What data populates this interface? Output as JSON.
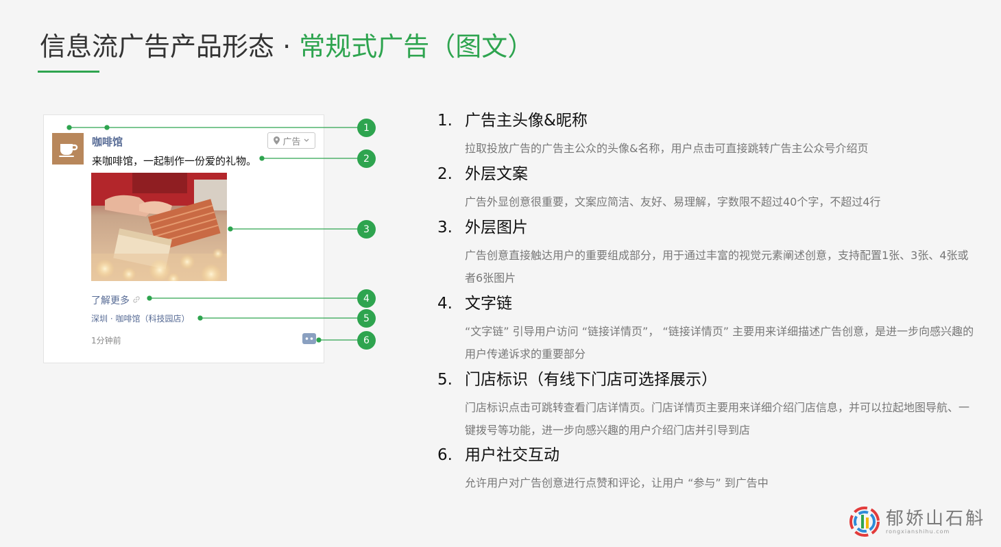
{
  "header": {
    "title_main": "信息流广告产品形态 · ",
    "title_accent": "常规式广告（图文）"
  },
  "ad_mock": {
    "nickname": "咖啡馆",
    "ad_tag": "广告",
    "copy": "来咖啡馆，一起制作一份爱的礼物。",
    "learn_more": "了解更多",
    "store": "深圳 · 咖啡馆（科技园店）",
    "time_ago": "1分钟前",
    "avatar_icon": "coffee-cup-icon",
    "colors": {
      "accent": "#2ea44f",
      "link": "#576b95",
      "avatar": "#b8875b"
    }
  },
  "callouts": [
    "1",
    "2",
    "3",
    "4",
    "5",
    "6"
  ],
  "features": [
    {
      "num": "1.",
      "title": "广告主头像&昵称",
      "desc": "拉取投放广告的广告主公众的头像&名称，用户点击可直接跳转广告主公众号介绍页"
    },
    {
      "num": "2.",
      "title": "外层文案",
      "desc": "广告外显创意很重要，文案应简洁、友好、易理解，字数限不超过40个字，不超过4行"
    },
    {
      "num": "3.",
      "title": "外层图片",
      "desc": "广告创意直接触达用户的重要组成部分，用于通过丰富的视觉元素阐述创意，支持配置1张、3张、4张或者6张图片"
    },
    {
      "num": "4.",
      "title": "文字链",
      "desc": "“文字链” 引导用户访问 “链接详情页”， “链接详情页” 主要用来详细描述广告创意，是进一步向感兴趣的用户传递诉求的重要部分"
    },
    {
      "num": "5.",
      "title": "门店标识（有线下门店可选择展示）",
      "desc": "门店标识点击可跳转查看门店详情页。门店详情页主要用来详细介绍门店信息，并可以拉起地图导航、一键拨号等功能，进一步向感兴趣的用户介绍门店并引导到店"
    },
    {
      "num": "6.",
      "title": "用户社交互动",
      "desc": "允许用户对广告创意进行点赞和评论，让用户 “参与” 到广告中"
    }
  ],
  "watermark": {
    "name": "郁娇山石斛",
    "url": "rongxianshihu.com"
  }
}
